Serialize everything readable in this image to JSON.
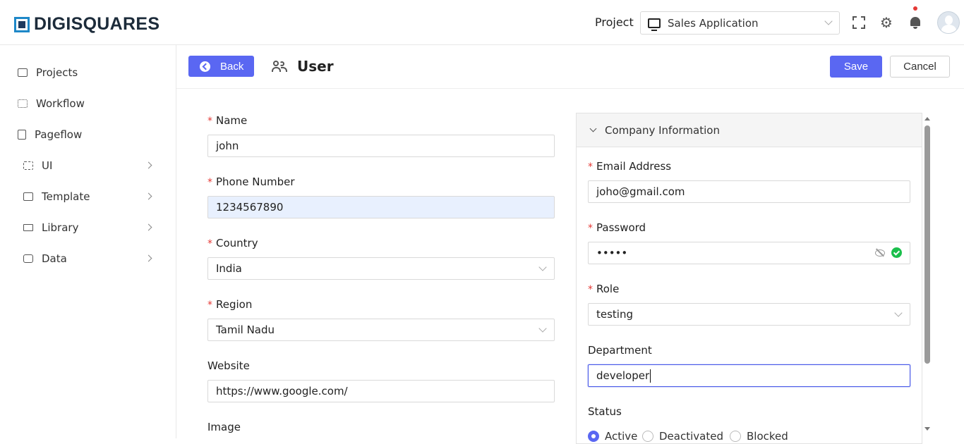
{
  "brand": {
    "name": "DIGISQUARES"
  },
  "topbar": {
    "project_label": "Project",
    "project_value": "Sales Application"
  },
  "sidebar": {
    "items": [
      {
        "label": "Projects",
        "icon": "folder-open-icon",
        "has_arrow": false
      },
      {
        "label": "Workflow",
        "icon": "workflow-icon",
        "has_arrow": false
      },
      {
        "label": "Pageflow",
        "icon": "pageflow-icon",
        "has_arrow": false
      },
      {
        "label": "UI",
        "icon": "ui-grid-icon",
        "has_arrow": true
      },
      {
        "label": "Template",
        "icon": "template-icon",
        "has_arrow": true
      },
      {
        "label": "Library",
        "icon": "library-icon",
        "has_arrow": true
      },
      {
        "label": "Data",
        "icon": "data-icon",
        "has_arrow": true
      }
    ]
  },
  "header": {
    "back_label": "Back",
    "title": "User",
    "save_label": "Save",
    "cancel_label": "Cancel"
  },
  "form_left": {
    "name": {
      "label": "Name",
      "value": "john"
    },
    "phone": {
      "label": "Phone Number",
      "value": "1234567890"
    },
    "country": {
      "label": "Country",
      "value": "India"
    },
    "region": {
      "label": "Region",
      "value": "Tamil Nadu"
    },
    "website": {
      "label": "Website",
      "value": "https://www.google.com/"
    },
    "image": {
      "label": "Image"
    }
  },
  "panel": {
    "title": "Company Information",
    "email": {
      "label": "Email Address",
      "value": "joho@gmail.com"
    },
    "password": {
      "label": "Password",
      "value": "•••••"
    },
    "role": {
      "label": "Role",
      "value": "testing"
    },
    "department": {
      "label": "Department",
      "value": "developer"
    },
    "status": {
      "label": "Status",
      "options": [
        "Active",
        "Deactivated",
        "Blocked"
      ],
      "selected": "Active"
    }
  },
  "colors": {
    "primary": "#5a67f2",
    "required": "#e53935",
    "success": "#1bbf4c",
    "autofill": "#e8f0fe",
    "logo_blue": "#1e88c8"
  }
}
